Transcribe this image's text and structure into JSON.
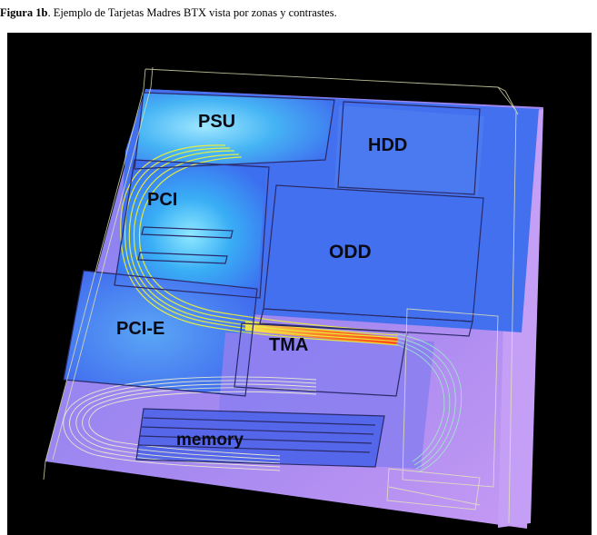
{
  "caption": {
    "label": "Figura 1b",
    "text": ". Ejemplo de Tarjetas Madres BTX vista por zonas y contrastes."
  },
  "zones": {
    "psu": "PSU",
    "hdd": "HDD",
    "pci": "PCI",
    "odd": "ODD",
    "pcie": "PCI-E",
    "tma": "TMA",
    "memory": "memory"
  },
  "colors": {
    "background": "#000000",
    "floor": "#b58cf2",
    "cool": "#3f74f0",
    "hot": "#ff5a1e",
    "flow": "#e8f03a",
    "wireframe": "#2a2a6a"
  }
}
